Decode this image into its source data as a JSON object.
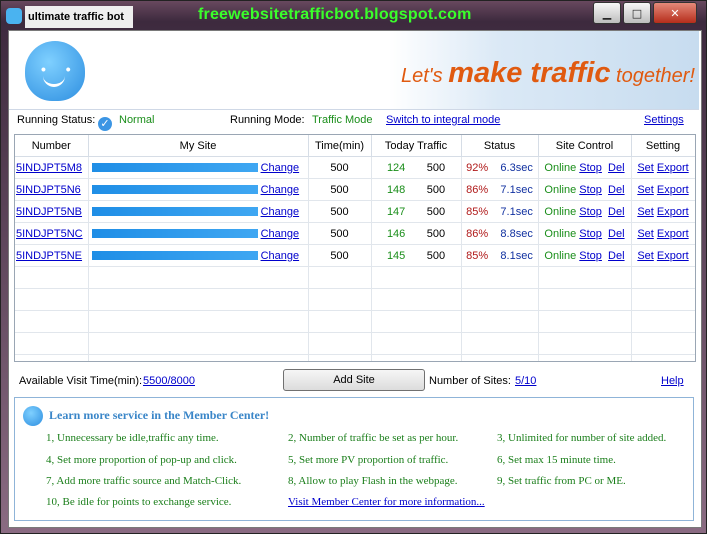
{
  "window": {
    "title": "ultimate traffic bot",
    "watermark": "freewebsitetrafficbot.blogspot.com",
    "controls": [
      "minimize-icon",
      "maximize-icon",
      "close-icon"
    ],
    "minimize_glyph": "▁",
    "maximize_glyph": "□",
    "close_glyph": "✕"
  },
  "banner": {
    "slogan_prefix": "Let's ",
    "slogan_big": "make traffic",
    "slogan_suffix": " together!",
    "mascot_eyes": "• •",
    "accent_color": "#e05a10"
  },
  "status": {
    "running_status_label": "Running Status:",
    "running_status_icon": "check-icon",
    "running_status_icon_glyph": "✓",
    "running_status_value": "Normal",
    "running_mode_label": "Running Mode:",
    "running_mode_value": "Traffic Mode",
    "switch_link": "Switch to integral mode",
    "settings_link": "Settings"
  },
  "table": {
    "headers": [
      "Number",
      "My Site",
      "Time(min)",
      "Today Traffic",
      "Status",
      "Site Control",
      "Setting"
    ],
    "rows": [
      {
        "number": "5INDJPT5M8",
        "change": "Change",
        "time": "500",
        "today": "124",
        "total": "500",
        "pct": "92%",
        "sec": "6.3sec",
        "online": "Online",
        "stop": "Stop",
        "del": "Del",
        "set": "Set",
        "export": "Export"
      },
      {
        "number": "5INDJPT5N6",
        "change": "Change",
        "time": "500",
        "today": "148",
        "total": "500",
        "pct": "86%",
        "sec": "7.1sec",
        "online": "Online",
        "stop": "Stop",
        "del": "Del",
        "set": "Set",
        "export": "Export"
      },
      {
        "number": "5INDJPT5NB",
        "change": "Change",
        "time": "500",
        "today": "147",
        "total": "500",
        "pct": "85%",
        "sec": "7.1sec",
        "online": "Online",
        "stop": "Stop",
        "del": "Del",
        "set": "Set",
        "export": "Export"
      },
      {
        "number": "5INDJPT5NC",
        "change": "Change",
        "time": "500",
        "today": "146",
        "total": "500",
        "pct": "86%",
        "sec": "8.8sec",
        "online": "Online",
        "stop": "Stop",
        "del": "Del",
        "set": "Set",
        "export": "Export"
      },
      {
        "number": "5INDJPT5NE",
        "change": "Change",
        "time": "500",
        "today": "145",
        "total": "500",
        "pct": "85%",
        "sec": "8.1sec",
        "online": "Online",
        "stop": "Stop",
        "del": "Del",
        "set": "Set",
        "export": "Export"
      }
    ]
  },
  "bottom": {
    "visit_time_label": "Available Visit Time(min):",
    "visit_time_value": "5500/8000",
    "add_site_button": "Add Site",
    "num_sites_label": "Number of Sites:",
    "num_sites_value": "5/10",
    "help_link": "Help"
  },
  "member": {
    "title": "Learn more service in the Member Center!",
    "items": [
      "1, Unnecessary be idle,traffic any time.",
      "2, Number of traffic be set as per hour.",
      "3, Unlimited for number of site added.",
      "4, Set more proportion of pop-up and click.",
      "5, Set more PV proportion of traffic.",
      "6, Set max 15 minute time.",
      "7, Add more traffic source and Match-Click.",
      "8, Allow to play Flash in the webpage.",
      "9, Set traffic from PC or ME.",
      "10, Be idle for points to exchange service."
    ],
    "visit_link": "Visit Member Center for more information..."
  }
}
